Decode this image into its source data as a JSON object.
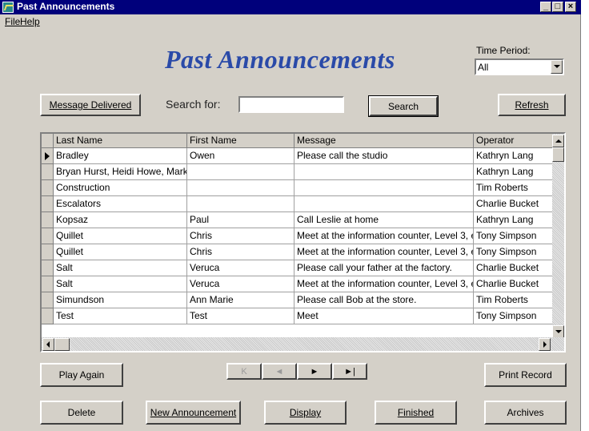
{
  "window": {
    "title": "Past Announcements"
  },
  "menu": {
    "file": "File",
    "help": "Help"
  },
  "heading": "Past Announcements",
  "time_period": {
    "label": "Time Period:",
    "value": "All"
  },
  "toolbar": {
    "message_delivered": "Message Delivered",
    "search_label": "Search for:",
    "search_value": "",
    "search": "Search",
    "refresh": "Refresh"
  },
  "table": {
    "columns": [
      "Last Name",
      "First Name",
      "Message",
      "Operator"
    ],
    "rows": [
      [
        "Bradley",
        "Owen",
        "Please call the studio",
        "Kathryn Lang"
      ],
      [
        "Bryan Hurst, Heidi Howe, Mark",
        "",
        "",
        "Kathryn Lang"
      ],
      [
        "Construction",
        "",
        "",
        "Tim Roberts"
      ],
      [
        "Escalators",
        "",
        "",
        "Charlie Bucket"
      ],
      [
        "Kopsaz",
        "Paul",
        "Call Leslie at home",
        "Kathryn Lang"
      ],
      [
        "Quillet",
        "Chris",
        "Meet at the information counter, Level 3, e",
        "Tony Simpson"
      ],
      [
        "Quillet",
        "Chris",
        "Meet at the information counter, Level 3, e",
        "Tony Simpson"
      ],
      [
        "Salt",
        "Veruca",
        "Please call your father at the factory.",
        "Charlie Bucket"
      ],
      [
        "Salt",
        "Veruca",
        "Meet at the information counter, Level 3, e",
        "Charlie Bucket"
      ],
      [
        "Simundson",
        "Ann Marie",
        "Please call Bob at the store.",
        "Tim Roberts"
      ],
      [
        "Test",
        "Test",
        "Meet",
        "Tony Simpson"
      ]
    ]
  },
  "buttons": {
    "play_again": "Play Again",
    "print_record": "Print Record",
    "delete": "Delete",
    "new_announcement": "New Announcement",
    "display": "Display",
    "finished": "Finished",
    "archives": "Archives"
  },
  "nav": {
    "first": "K",
    "prev": "◄",
    "next": "►",
    "last": "►|"
  },
  "colors": {
    "title_bar": "#00007b",
    "heading": "#2a4aa8",
    "face": "#d4d0c8"
  }
}
